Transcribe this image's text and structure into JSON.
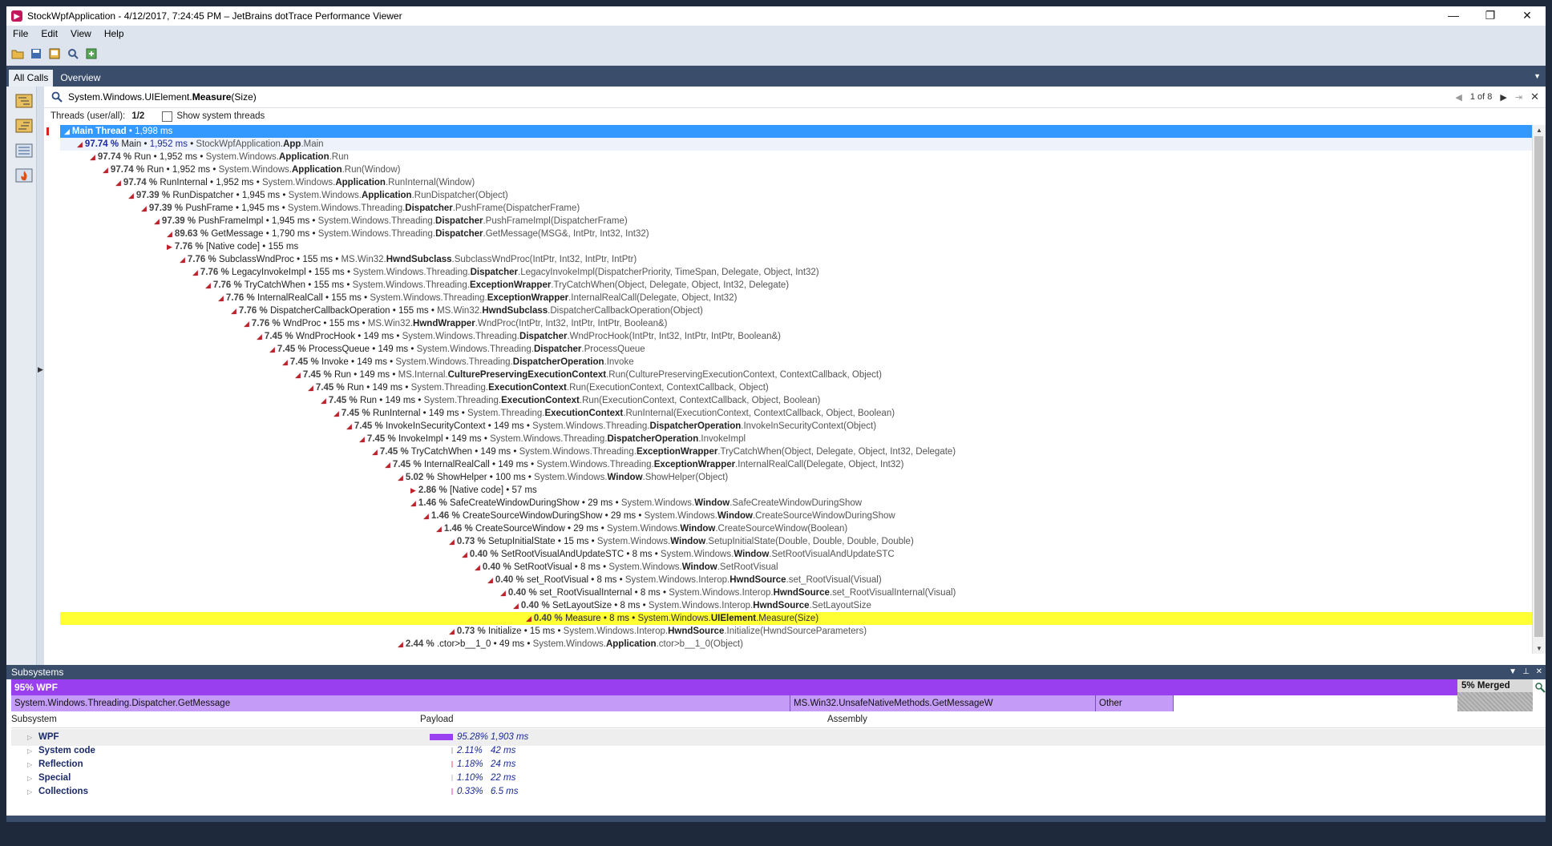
{
  "window": {
    "title": "StockWpfApplication - 4/12/2017, 7:24:45 PM – JetBrains dotTrace Performance Viewer",
    "minimize": "—",
    "maximize": "❐",
    "close": "✕"
  },
  "menu": [
    "File",
    "Edit",
    "View",
    "Help"
  ],
  "tabs": [
    "All Calls",
    "Overview"
  ],
  "search": {
    "query_prefix": "System.Windows.UIElement.",
    "query_bold": "Measure",
    "query_suffix": "(Size)",
    "nav_text": "1 of 8"
  },
  "threads": {
    "label": "Threads (user/all):",
    "value": "1/2",
    "show_system_label": "Show system threads"
  },
  "tree_rows": [
    {
      "depth": 0,
      "pct": "",
      "name": "Main Thread",
      "time": "1,998 ms",
      "ns": "",
      "cls": "",
      "rest": "",
      "state": "selected"
    },
    {
      "depth": 1,
      "pct": "97.74 %",
      "name": "Main",
      "time": "1,952 ms",
      "ns": "StockWpfApplication.",
      "cls": "App",
      "rest": ".Main",
      "state": "light"
    },
    {
      "depth": 2,
      "pct": "97.74 %",
      "name": "Run",
      "time": "1,952 ms",
      "ns": "System.Windows.",
      "cls": "Application",
      "rest": ".Run",
      "state": ""
    },
    {
      "depth": 3,
      "pct": "97.74 %",
      "name": "Run",
      "time": "1,952 ms",
      "ns": "System.Windows.",
      "cls": "Application",
      "rest": ".Run(Window)",
      "state": ""
    },
    {
      "depth": 4,
      "pct": "97.74 %",
      "name": "RunInternal",
      "time": "1,952 ms",
      "ns": "System.Windows.",
      "cls": "Application",
      "rest": ".RunInternal(Window)",
      "state": ""
    },
    {
      "depth": 5,
      "pct": "97.39 %",
      "name": "RunDispatcher",
      "time": "1,945 ms",
      "ns": "System.Windows.",
      "cls": "Application",
      "rest": ".RunDispatcher(Object)",
      "state": ""
    },
    {
      "depth": 6,
      "pct": "97.39 %",
      "name": "PushFrame",
      "time": "1,945 ms",
      "ns": "System.Windows.Threading.",
      "cls": "Dispatcher",
      "rest": ".PushFrame(DispatcherFrame)",
      "state": ""
    },
    {
      "depth": 7,
      "pct": "97.39 %",
      "name": "PushFrameImpl",
      "time": "1,945 ms",
      "ns": "System.Windows.Threading.",
      "cls": "Dispatcher",
      "rest": ".PushFrameImpl(DispatcherFrame)",
      "state": ""
    },
    {
      "depth": 8,
      "pct": "89.63 %",
      "name": "GetMessage",
      "time": "1,790 ms",
      "ns": "System.Windows.Threading.",
      "cls": "Dispatcher",
      "rest": ".GetMessage(MSG&, IntPtr, Int32, Int32)",
      "state": ""
    },
    {
      "depth": 8,
      "pct": "7.76 %",
      "name": "[Native code]",
      "time": "155 ms",
      "ns": "",
      "cls": "",
      "rest": "",
      "state": ""
    },
    {
      "depth": 9,
      "pct": "7.76 %",
      "name": "SubclassWndProc",
      "time": "155 ms",
      "ns": "MS.Win32.",
      "cls": "HwndSubclass",
      "rest": ".SubclassWndProc(IntPtr, Int32, IntPtr, IntPtr)",
      "state": ""
    },
    {
      "depth": 10,
      "pct": "7.76 %",
      "name": "LegacyInvokeImpl",
      "time": "155 ms",
      "ns": "System.Windows.Threading.",
      "cls": "Dispatcher",
      "rest": ".LegacyInvokeImpl(DispatcherPriority, TimeSpan, Delegate, Object, Int32)",
      "state": ""
    },
    {
      "depth": 11,
      "pct": "7.76 %",
      "name": "TryCatchWhen",
      "time": "155 ms",
      "ns": "System.Windows.Threading.",
      "cls": "ExceptionWrapper",
      "rest": ".TryCatchWhen(Object, Delegate, Object, Int32, Delegate)",
      "state": ""
    },
    {
      "depth": 12,
      "pct": "7.76 %",
      "name": "InternalRealCall",
      "time": "155 ms",
      "ns": "System.Windows.Threading.",
      "cls": "ExceptionWrapper",
      "rest": ".InternalRealCall(Delegate, Object, Int32)",
      "state": ""
    },
    {
      "depth": 13,
      "pct": "7.76 %",
      "name": "DispatcherCallbackOperation",
      "time": "155 ms",
      "ns": "MS.Win32.",
      "cls": "HwndSubclass",
      "rest": ".DispatcherCallbackOperation(Object)",
      "state": ""
    },
    {
      "depth": 14,
      "pct": "7.76 %",
      "name": "WndProc",
      "time": "155 ms",
      "ns": "MS.Win32.",
      "cls": "HwndWrapper",
      "rest": ".WndProc(IntPtr, Int32, IntPtr, IntPtr, Boolean&)",
      "state": ""
    },
    {
      "depth": 15,
      "pct": "7.45 %",
      "name": "WndProcHook",
      "time": "149 ms",
      "ns": "System.Windows.Threading.",
      "cls": "Dispatcher",
      "rest": ".WndProcHook(IntPtr, Int32, IntPtr, IntPtr, Boolean&)",
      "state": ""
    },
    {
      "depth": 16,
      "pct": "7.45 %",
      "name": "ProcessQueue",
      "time": "149 ms",
      "ns": "System.Windows.Threading.",
      "cls": "Dispatcher",
      "rest": ".ProcessQueue",
      "state": ""
    },
    {
      "depth": 17,
      "pct": "7.45 %",
      "name": "Invoke",
      "time": "149 ms",
      "ns": "System.Windows.Threading.",
      "cls": "DispatcherOperation",
      "rest": ".Invoke",
      "state": ""
    },
    {
      "depth": 18,
      "pct": "7.45 %",
      "name": "Run",
      "time": "149 ms",
      "ns": "MS.Internal.",
      "cls": "CulturePreservingExecutionContext",
      "rest": ".Run(CulturePreservingExecutionContext, ContextCallback, Object)",
      "state": ""
    },
    {
      "depth": 19,
      "pct": "7.45 %",
      "name": "Run",
      "time": "149 ms",
      "ns": "System.Threading.",
      "cls": "ExecutionContext",
      "rest": ".Run(ExecutionContext, ContextCallback, Object)",
      "state": ""
    },
    {
      "depth": 20,
      "pct": "7.45 %",
      "name": "Run",
      "time": "149 ms",
      "ns": "System.Threading.",
      "cls": "ExecutionContext",
      "rest": ".Run(ExecutionContext, ContextCallback, Object, Boolean)",
      "state": ""
    },
    {
      "depth": 21,
      "pct": "7.45 %",
      "name": "RunInternal",
      "time": "149 ms",
      "ns": "System.Threading.",
      "cls": "ExecutionContext",
      "rest": ".RunInternal(ExecutionContext, ContextCallback, Object, Boolean)",
      "state": ""
    },
    {
      "depth": 22,
      "pct": "7.45 %",
      "name": "InvokeInSecurityContext",
      "time": "149 ms",
      "ns": "System.Windows.Threading.",
      "cls": "DispatcherOperation",
      "rest": ".InvokeInSecurityContext(Object)",
      "state": ""
    },
    {
      "depth": 23,
      "pct": "7.45 %",
      "name": "InvokeImpl",
      "time": "149 ms",
      "ns": "System.Windows.Threading.",
      "cls": "DispatcherOperation",
      "rest": ".InvokeImpl",
      "state": ""
    },
    {
      "depth": 24,
      "pct": "7.45 %",
      "name": "TryCatchWhen",
      "time": "149 ms",
      "ns": "System.Windows.Threading.",
      "cls": "ExceptionWrapper",
      "rest": ".TryCatchWhen(Object, Delegate, Object, Int32, Delegate)",
      "state": ""
    },
    {
      "depth": 25,
      "pct": "7.45 %",
      "name": "InternalRealCall",
      "time": "149 ms",
      "ns": "System.Windows.Threading.",
      "cls": "ExceptionWrapper",
      "rest": ".InternalRealCall(Delegate, Object, Int32)",
      "state": ""
    },
    {
      "depth": 26,
      "pct": "5.02 %",
      "name": "ShowHelper",
      "time": "100 ms",
      "ns": "System.Windows.",
      "cls": "Window",
      "rest": ".ShowHelper(Object)",
      "state": ""
    },
    {
      "depth": 27,
      "pct": "2.86 %",
      "name": "[Native code]",
      "time": "57 ms",
      "ns": "",
      "cls": "",
      "rest": "",
      "state": ""
    },
    {
      "depth": 27,
      "pct": "1.46 %",
      "name": "SafeCreateWindowDuringShow",
      "time": "29 ms",
      "ns": "System.Windows.",
      "cls": "Window",
      "rest": ".SafeCreateWindowDuringShow",
      "state": ""
    },
    {
      "depth": 28,
      "pct": "1.46 %",
      "name": "CreateSourceWindowDuringShow",
      "time": "29 ms",
      "ns": "System.Windows.",
      "cls": "Window",
      "rest": ".CreateSourceWindowDuringShow",
      "state": ""
    },
    {
      "depth": 29,
      "pct": "1.46 %",
      "name": "CreateSourceWindow",
      "time": "29 ms",
      "ns": "System.Windows.",
      "cls": "Window",
      "rest": ".CreateSourceWindow(Boolean)",
      "state": ""
    },
    {
      "depth": 30,
      "pct": "0.73 %",
      "name": "SetupInitialState",
      "time": "15 ms",
      "ns": "System.Windows.",
      "cls": "Window",
      "rest": ".SetupInitialState(Double, Double, Double, Double)",
      "state": ""
    },
    {
      "depth": 31,
      "pct": "0.40 %",
      "name": "SetRootVisualAndUpdateSTC",
      "time": "8 ms",
      "ns": "System.Windows.",
      "cls": "Window",
      "rest": ".SetRootVisualAndUpdateSTC",
      "state": ""
    },
    {
      "depth": 32,
      "pct": "0.40 %",
      "name": "SetRootVisual",
      "time": "8 ms",
      "ns": "System.Windows.",
      "cls": "Window",
      "rest": ".SetRootVisual",
      "state": ""
    },
    {
      "depth": 33,
      "pct": "0.40 %",
      "name": "set_RootVisual",
      "time": "8 ms",
      "ns": "System.Windows.Interop.",
      "cls": "HwndSource",
      "rest": ".set_RootVisual(Visual)",
      "state": ""
    },
    {
      "depth": 34,
      "pct": "0.40 %",
      "name": "set_RootVisualInternal",
      "time": "8 ms",
      "ns": "System.Windows.Interop.",
      "cls": "HwndSource",
      "rest": ".set_RootVisualInternal(Visual)",
      "state": ""
    },
    {
      "depth": 35,
      "pct": "0.40 %",
      "name": "SetLayoutSize",
      "time": "8 ms",
      "ns": "System.Windows.Interop.",
      "cls": "HwndSource",
      "rest": ".SetLayoutSize",
      "state": ""
    },
    {
      "depth": 36,
      "pct": "0.40 %",
      "name": "Measure",
      "time": "8 ms",
      "ns": "System.Windows.",
      "cls": "UIElement",
      "rest": ".Measure(Size)",
      "state": "match"
    },
    {
      "depth": 30,
      "pct": "0.73 %",
      "name": "Initialize",
      "time": "15 ms",
      "ns": "System.Windows.Interop.",
      "cls": "HwndSource",
      "rest": ".Initialize(HwndSourceParameters)",
      "state": ""
    },
    {
      "depth": 26,
      "pct": "2.44 %",
      "name": ".ctor>b__1_0",
      "time": "49 ms",
      "ns": "System.Windows.",
      "cls": "Application",
      "rest": ".ctor>b__1_0(Object)",
      "state": ""
    }
  ],
  "subsystems": {
    "title": "Subsystems",
    "bar_label": "95% WPF",
    "merged_label": "5% Merged",
    "segments": [
      {
        "label": "System.Windows.Threading.Dispatcher.GetMessage",
        "frac": 0.539
      },
      {
        "label": "MS.Win32.UnsafeNativeMethods.GetMessageW",
        "frac": 0.211
      },
      {
        "label": "Other",
        "frac": 0.054
      }
    ],
    "headers": {
      "subsystem": "Subsystem",
      "payload": "Payload",
      "assembly": "Assembly"
    },
    "rows": [
      {
        "name": "WPF",
        "pct": "95.28%",
        "ms": "1,903 ms",
        "color": "#9a3ff0",
        "frac": 0.9528
      },
      {
        "name": "System code",
        "pct": "2.11%",
        "ms": "42 ms",
        "color": "#d0d0d0",
        "frac": 0.0211
      },
      {
        "name": "Reflection",
        "pct": "1.18%",
        "ms": "24 ms",
        "color": "#f2a7b6",
        "frac": 0.0118
      },
      {
        "name": "Special",
        "pct": "1.10%",
        "ms": "22 ms",
        "color": "#dcdcdc",
        "frac": 0.011
      },
      {
        "name": "Collections",
        "pct": "0.33%",
        "ms": "6.5 ms",
        "color": "#f0a0d8",
        "frac": 0.0033
      }
    ]
  }
}
